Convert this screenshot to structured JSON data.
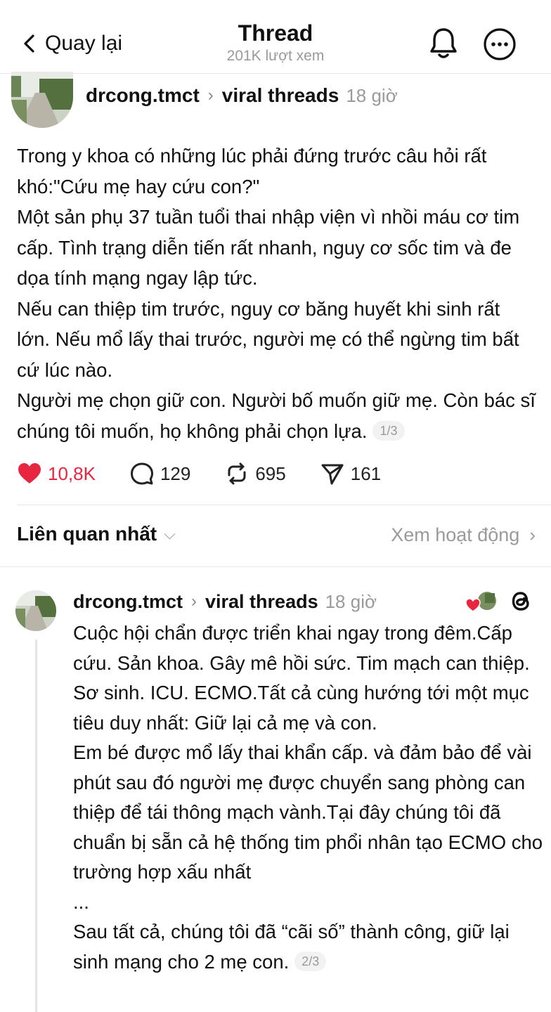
{
  "header": {
    "back_label": "Quay lại",
    "title": "Thread",
    "subtitle": "201K lượt xem"
  },
  "post": {
    "username": "drcong.tmct",
    "community": "viral threads",
    "time": "18 giờ",
    "paragraphs": [
      "Trong y khoa có những lúc phải đứng trước câu hỏi rất khó:\"Cứu mẹ hay cứu con?\"",
      "Một sản phụ 37 tuần tuổi thai nhập viện vì nhồi máu cơ tim cấp. Tình trạng diễn tiến rất nhanh, nguy cơ sốc tim và đe dọa tính mạng ngay lập tức.",
      "Nếu can thiệp tim trước, nguy cơ băng huyết khi sinh rất lớn. Nếu mổ lấy thai trước, người mẹ có thể ngừng tim bất cứ lúc nào.",
      "Người mẹ chọn giữ con. Người bố muốn giữ mẹ. Còn bác sĩ chúng tôi muốn, họ không phải chọn lựa."
    ],
    "page": "1/3",
    "likes": "10,8K",
    "comments": "129",
    "reposts": "695",
    "shares": "161",
    "like_color": "#e8263f"
  },
  "sort": {
    "left_label": "Liên quan nhất",
    "right_label": "Xem hoạt động"
  },
  "reply": {
    "username": "drcong.tmct",
    "community": "viral threads",
    "time": "18 giờ",
    "paragraphs": [
      "Cuộc hội chẩn được triển khai ngay trong đêm.Cấp cứu. Sản khoa. Gây mê hồi sức. Tim mạch can thiệp. Sơ sinh. ICU. ECMO.Tất cả cùng hướng tới một mục tiêu duy nhất: Giữ lại cả mẹ và con.",
      "Em bé được mổ lấy thai khẩn cấp. và đảm bảo để vài phút sau đó người mẹ được chuyển sang phòng can thiệp để tái thông mạch vành.Tại đây chúng tôi đã chuẩn bị sẵn cả hệ thống tim phổi nhân tạo ECMO cho trường hợp xấu nhất",
      "...",
      "Sau tất cả, chúng tôi đã “cãi số” thành công, giữ lại sinh mạng cho 2 mẹ con."
    ],
    "page": "2/3"
  },
  "icons": {
    "back": "chevron-left-icon",
    "bell": "bell-icon",
    "more": "more-circle-icon",
    "heart": "heart-icon",
    "comment": "comment-bubble-icon",
    "repost": "repost-icon",
    "share": "send-icon",
    "threads": "threads-logo-icon"
  }
}
